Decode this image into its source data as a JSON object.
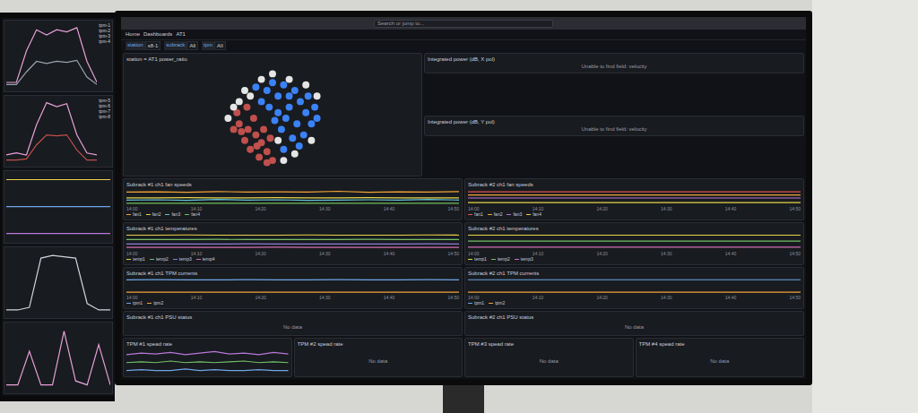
{
  "browser": {
    "search": "Search or jump to...",
    "breadcrumb": [
      "Home",
      "Dashboards",
      "AT1"
    ]
  },
  "variables": [
    {
      "label": "station",
      "value": "s8-1"
    },
    {
      "label": "subrack",
      "value": "All"
    },
    {
      "label": "tpm",
      "value": "All"
    }
  ],
  "scatter": {
    "title": "station = AT1 power_ratio",
    "groups": [
      {
        "color": "#3b82f6",
        "points": [
          [
            60,
            20
          ],
          [
            70,
            25
          ],
          [
            55,
            30
          ],
          [
            75,
            35
          ],
          [
            65,
            40
          ],
          [
            80,
            45
          ],
          [
            85,
            55
          ],
          [
            72,
            55
          ],
          [
            62,
            50
          ],
          [
            55,
            45
          ],
          [
            45,
            25
          ],
          [
            40,
            35
          ],
          [
            50,
            18
          ],
          [
            78,
            65
          ],
          [
            68,
            68
          ],
          [
            58,
            60
          ],
          [
            88,
            40
          ],
          [
            35,
            22
          ],
          [
            47,
            40
          ],
          [
            82,
            30
          ],
          [
            65,
            30
          ],
          [
            74,
            75
          ],
          [
            60,
            78
          ],
          [
            90,
            50
          ],
          [
            52,
            52
          ]
        ]
      },
      {
        "color": "#c0504d",
        "points": [
          [
            20,
            55
          ],
          [
            28,
            60
          ],
          [
            35,
            65
          ],
          [
            25,
            70
          ],
          [
            40,
            72
          ],
          [
            30,
            78
          ],
          [
            45,
            80
          ],
          [
            18,
            45
          ],
          [
            33,
            50
          ],
          [
            42,
            60
          ],
          [
            38,
            85
          ],
          [
            22,
            62
          ],
          [
            48,
            68
          ],
          [
            27,
            40
          ],
          [
            15,
            60
          ],
          [
            50,
            88
          ],
          [
            36,
            75
          ],
          [
            45,
            90
          ]
        ]
      },
      {
        "color": "#e5e5e5",
        "points": [
          [
            30,
            30
          ],
          [
            25,
            25
          ],
          [
            40,
            15
          ],
          [
            15,
            40
          ],
          [
            60,
            88
          ],
          [
            70,
            82
          ],
          [
            85,
            70
          ],
          [
            10,
            50
          ],
          [
            50,
            10
          ],
          [
            90,
            30
          ],
          [
            20,
            35
          ],
          [
            55,
            70
          ],
          [
            65,
            15
          ],
          [
            80,
            20
          ]
        ]
      }
    ]
  },
  "power_panels": [
    {
      "title": "Integrated power (dB, X pol)",
      "message": "Unable to find field: velocity"
    },
    {
      "title": "Integrated power (dB, Y pol)",
      "message": "Unable to find field: velocity"
    }
  ],
  "axis_times": [
    "14:00",
    "14:10",
    "14:20",
    "14:30",
    "14:40",
    "14:50"
  ],
  "timeseries": [
    {
      "title": "Subrack #1 ch1 fan speeds",
      "series": [
        {
          "name": "fan1",
          "color": "#f2a33a",
          "values": [
            92,
            93,
            91,
            94,
            92,
            93,
            92,
            95,
            91,
            93,
            92,
            94
          ]
        },
        {
          "name": "fan2",
          "color": "#e9d44b",
          "values": [
            70,
            70,
            71,
            70,
            70,
            71,
            70,
            70,
            71,
            70,
            70,
            70
          ]
        },
        {
          "name": "fan3",
          "color": "#5ec4d6",
          "values": [
            62,
            63,
            61,
            64,
            62,
            63,
            61,
            62,
            63,
            62,
            64,
            62
          ]
        },
        {
          "name": "fan4",
          "color": "#6fbf5a",
          "values": [
            50,
            50,
            50,
            50,
            50,
            50,
            50,
            50,
            50,
            50,
            50,
            50
          ]
        }
      ]
    },
    {
      "title": "Subrack #2 ch1 fan speeds",
      "series": [
        {
          "name": "fan1",
          "color": "#e0554f",
          "values": [
            88,
            88,
            88,
            88,
            88,
            88,
            88,
            88,
            88,
            88,
            88,
            88
          ]
        },
        {
          "name": "fan2",
          "color": "#f2a33a",
          "values": [
            80,
            80,
            80,
            80,
            80,
            80,
            80,
            80,
            80,
            80,
            80,
            80
          ]
        },
        {
          "name": "fan3",
          "color": "#b877d9",
          "values": [
            72,
            72,
            72,
            72,
            72,
            72,
            72,
            72,
            72,
            72,
            72,
            72
          ]
        },
        {
          "name": "fan4",
          "color": "#e9d44b",
          "values": [
            60,
            60,
            60,
            60,
            60,
            60,
            60,
            60,
            60,
            60,
            60,
            60
          ]
        }
      ]
    },
    {
      "title": "Subrack #1 ch1 temperatures",
      "series": [
        {
          "name": "temp1",
          "color": "#e9d44b",
          "values": [
            85,
            85,
            86,
            85,
            85,
            85,
            86,
            85,
            85,
            85,
            86,
            85
          ]
        },
        {
          "name": "temp2",
          "color": "#73bf69",
          "values": [
            65,
            65,
            65,
            66,
            65,
            65,
            65,
            65,
            66,
            65,
            65,
            65
          ]
        },
        {
          "name": "temp3",
          "color": "#8f7cd9",
          "values": [
            45,
            45,
            45,
            45,
            46,
            45,
            45,
            45,
            45,
            45,
            46,
            45
          ]
        },
        {
          "name": "temp4",
          "color": "#d36fb3",
          "values": [
            30,
            30,
            30,
            30,
            30,
            31,
            30,
            30,
            30,
            30,
            30,
            30
          ]
        }
      ]
    },
    {
      "title": "Subrack #2 ch1 temperatures",
      "series": [
        {
          "name": "temp1",
          "color": "#e9d44b",
          "values": [
            82,
            82,
            82,
            82,
            82,
            82,
            82,
            82,
            82,
            82,
            82,
            82
          ]
        },
        {
          "name": "temp2",
          "color": "#73bf69",
          "values": [
            60,
            60,
            60,
            60,
            60,
            60,
            60,
            60,
            60,
            60,
            60,
            60
          ]
        },
        {
          "name": "temp3",
          "color": "#d36fb3",
          "values": [
            38,
            38,
            38,
            38,
            38,
            38,
            38,
            38,
            38,
            38,
            38,
            38
          ]
        }
      ]
    },
    {
      "title": "Subrack #1 ch1 TPM currents",
      "series": [
        {
          "name": "tpm1",
          "color": "#6ea6e6",
          "values": [
            80,
            81,
            80,
            80,
            81,
            80,
            80,
            81,
            80,
            80,
            81,
            80
          ]
        },
        {
          "name": "tpm2",
          "color": "#f2a33a",
          "values": [
            20,
            20,
            20,
            20,
            20,
            20,
            20,
            20,
            20,
            20,
            20,
            20
          ]
        }
      ]
    },
    {
      "title": "Subrack #2 ch1 TPM currents",
      "series": [
        {
          "name": "tpm1",
          "color": "#6ea6e6",
          "values": [
            78,
            78,
            78,
            78,
            78,
            78,
            78,
            78,
            78,
            78,
            78,
            78
          ]
        },
        {
          "name": "tpm2",
          "color": "#f2a33a",
          "values": [
            22,
            22,
            22,
            22,
            22,
            22,
            22,
            22,
            22,
            22,
            22,
            22
          ]
        }
      ]
    }
  ],
  "status_panels": [
    {
      "title": "Subrack #1 ch1 PSU status",
      "message": "No data"
    },
    {
      "title": "Subrack #2 ch1 PSU status",
      "message": "No data"
    }
  ],
  "small_panels": [
    {
      "title": "TPM #1 spead rate",
      "message": "",
      "series": [
        {
          "color": "#b877d9",
          "values": [
            40,
            42,
            41,
            43,
            40,
            42,
            44,
            41,
            42,
            40,
            43,
            41
          ]
        },
        {
          "color": "#73bf69",
          "values": [
            30,
            31,
            30,
            32,
            30,
            31,
            30,
            31,
            32,
            30,
            31,
            30
          ]
        },
        {
          "color": "#6ea6e6",
          "values": [
            20,
            21,
            20,
            20,
            22,
            20,
            21,
            20,
            20,
            21,
            20,
            20
          ]
        }
      ]
    },
    {
      "title": "TPM #2 spead rate",
      "message": "No data",
      "series": []
    },
    {
      "title": "TPM #3 spead rate",
      "message": "No data",
      "series": []
    },
    {
      "title": "TPM #4 spead rate",
      "message": "No data",
      "series": []
    }
  ],
  "left_monitor": {
    "panels": [
      {
        "legend": [
          "tpm-1",
          "tpm-2",
          "tpm-3",
          "tpm-4"
        ],
        "series": [
          {
            "color": "#e8a0d8",
            "values": [
              10,
              10,
              40,
              60,
              55,
              60,
              58,
              62,
              30,
              10
            ]
          },
          {
            "color": "#9ca3af",
            "values": [
              8,
              8,
              20,
              30,
              28,
              30,
              29,
              31,
              15,
              8
            ]
          }
        ]
      },
      {
        "legend": [
          "tpm-5",
          "tpm-6",
          "tpm-7",
          "tpm-8"
        ],
        "series": [
          {
            "color": "#e8a0d8",
            "values": [
              10,
              12,
              10,
              40,
              62,
              58,
              61,
              30,
              12,
              10
            ]
          },
          {
            "color": "#c0504d",
            "values": [
              5,
              5,
              6,
              20,
              30,
              29,
              30,
              15,
              5,
              5
            ]
          }
        ]
      },
      {
        "legend": [],
        "series": [
          {
            "color": "#e9d44b",
            "values": [
              60,
              60,
              60,
              60,
              60,
              60,
              60,
              60,
              60,
              60
            ]
          },
          {
            "color": "#6ea6e6",
            "values": [
              40,
              40,
              40,
              40,
              40,
              40,
              40,
              40,
              40,
              40
            ]
          },
          {
            "color": "#b877d9",
            "values": [
              20,
              20,
              20,
              20,
              20,
              20,
              20,
              20,
              20,
              20
            ]
          }
        ]
      },
      {
        "legend": [],
        "series": [
          {
            "color": "#d1d5db",
            "values": [
              20,
              20,
              22,
              60,
              62,
              61,
              60,
              25,
              20,
              20
            ]
          }
        ]
      },
      {
        "legend": [],
        "series": [
          {
            "color": "#e8a0d8",
            "values": [
              5,
              5,
              30,
              5,
              5,
              45,
              8,
              5,
              35,
              5
            ]
          }
        ]
      }
    ]
  }
}
